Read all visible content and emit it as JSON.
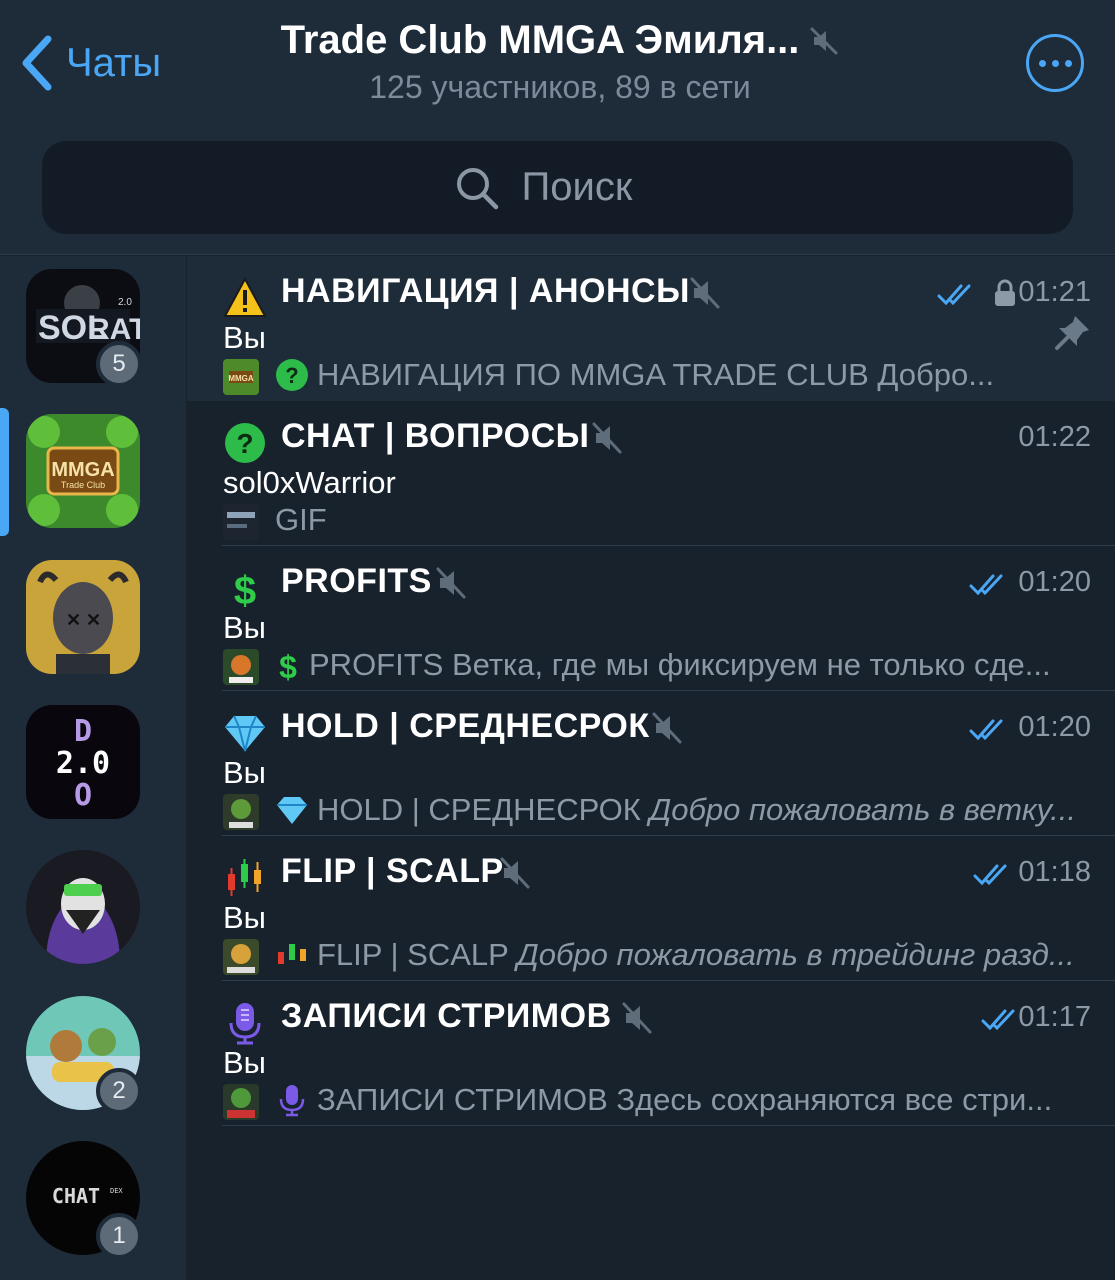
{
  "header": {
    "back_label": "Чаты",
    "title": "Trade Club MMGA Эмиля...",
    "subtitle": "125 участников, 89 в сети"
  },
  "search": {
    "placeholder": "Поиск"
  },
  "rail": {
    "avatars": [
      {
        "label": "SOLRAT 2.0",
        "badge": "5",
        "shape": "square"
      },
      {
        "label": "MMGA Trade Club",
        "badge": "",
        "shape": "square",
        "active": true
      },
      {
        "label": "goat",
        "badge": "",
        "shape": "square"
      },
      {
        "label": "DAO 2.0",
        "badge": "",
        "shape": "square"
      },
      {
        "label": "slay",
        "badge": "",
        "shape": "round"
      },
      {
        "label": "cartoon",
        "badge": "2",
        "shape": "round"
      },
      {
        "label": "CHAT",
        "badge": "1",
        "shape": "round"
      }
    ]
  },
  "topics": [
    {
      "icon": "warning-icon",
      "title": "НАВИГАЦИЯ | АНОНСЫ",
      "time": "01:21",
      "read": true,
      "locked": true,
      "pinned": true,
      "sender": "Вы",
      "preview_plain": "НАВИГАЦИЯ ПО MMGA TRADE CLUB Добро...",
      "preview_italic": ""
    },
    {
      "icon": "question-icon",
      "title": "CHAT | ВОПРОСЫ",
      "time": "01:22",
      "read": false,
      "locked": false,
      "pinned": false,
      "sender": "sol0xWarrior",
      "preview_plain": "GIF",
      "preview_italic": ""
    },
    {
      "icon": "dollar-icon",
      "title": "PROFITS",
      "time": "01:20",
      "read": true,
      "locked": false,
      "pinned": false,
      "sender": "Вы",
      "preview_plain": "PROFITS Ветка, где мы фиксируем не только сде...",
      "preview_italic": ""
    },
    {
      "icon": "diamond-icon",
      "title": "HOLD | СРЕДНЕСРОК",
      "time": "01:20",
      "read": true,
      "locked": false,
      "pinned": false,
      "sender": "Вы",
      "preview_plain": "HOLD | СРЕДНЕСРОК ",
      "preview_italic": "Добро пожаловать в ветку..."
    },
    {
      "icon": "candles-icon",
      "title": "FLIP | SCALP",
      "time": "01:18",
      "read": true,
      "locked": false,
      "pinned": false,
      "sender": "Вы",
      "preview_plain": "FLIP | SCALP ",
      "preview_italic": "Добро пожаловать в трейдинг разд..."
    },
    {
      "icon": "microphone-icon",
      "title": "ЗАПИСИ СТРИМОВ",
      "time": "01:17",
      "read": true,
      "locked": false,
      "pinned": false,
      "sender": "Вы",
      "preview_plain": "ЗАПИСИ СТРИМОВ Здесь сохраняются все стри...",
      "preview_italic": ""
    }
  ],
  "colors": {
    "accent": "#4aa7f5",
    "background": "#18222d",
    "panel": "#1e2b39",
    "muted_text": "#8c99a6"
  }
}
